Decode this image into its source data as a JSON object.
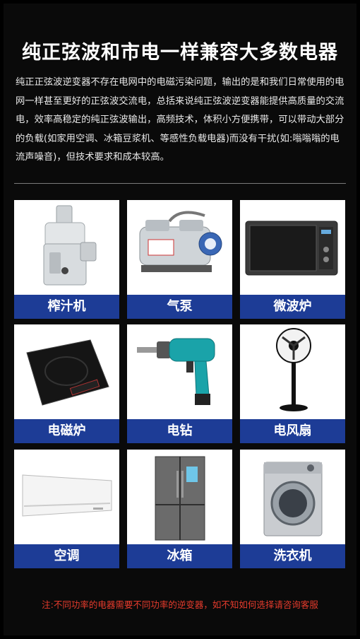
{
  "title": "纯正弦波和市电一样兼容大多数电器",
  "description": "纯正正弦波逆变器不存在电网中的电磁污染问题，输出的是和我们日常使用的电网一样甚至更好的正弦波交流电，总括来说纯正弦波逆变器能提供高质量的交流电，效率高稳定的纯正弦波输出，高频技术，体积小方便携带，可以带动大部分的负载(如家用空调、冰箱豆浆机、等感性负载电器)而没有干扰(如:嗡嗡嗡的电流声噪音)，但技术要求和成本较高。",
  "appliances": [
    {
      "label": "榨汁机",
      "icon": "juicer-icon"
    },
    {
      "label": "气泵",
      "icon": "air-pump-icon"
    },
    {
      "label": "微波炉",
      "icon": "microwave-icon"
    },
    {
      "label": "电磁炉",
      "icon": "induction-cooker-icon"
    },
    {
      "label": "电钻",
      "icon": "electric-drill-icon"
    },
    {
      "label": "电风扇",
      "icon": "electric-fan-icon"
    },
    {
      "label": "空调",
      "icon": "air-conditioner-icon"
    },
    {
      "label": "冰箱",
      "icon": "refrigerator-icon"
    },
    {
      "label": "洗衣机",
      "icon": "washing-machine-icon"
    }
  ],
  "note": "注:不同功率的电器需要不同功率的逆变器，如不知如何选择请咨询客服",
  "colors": {
    "label_bg": "#1d3c96",
    "note": "#e53b2c",
    "background": "#000000"
  }
}
